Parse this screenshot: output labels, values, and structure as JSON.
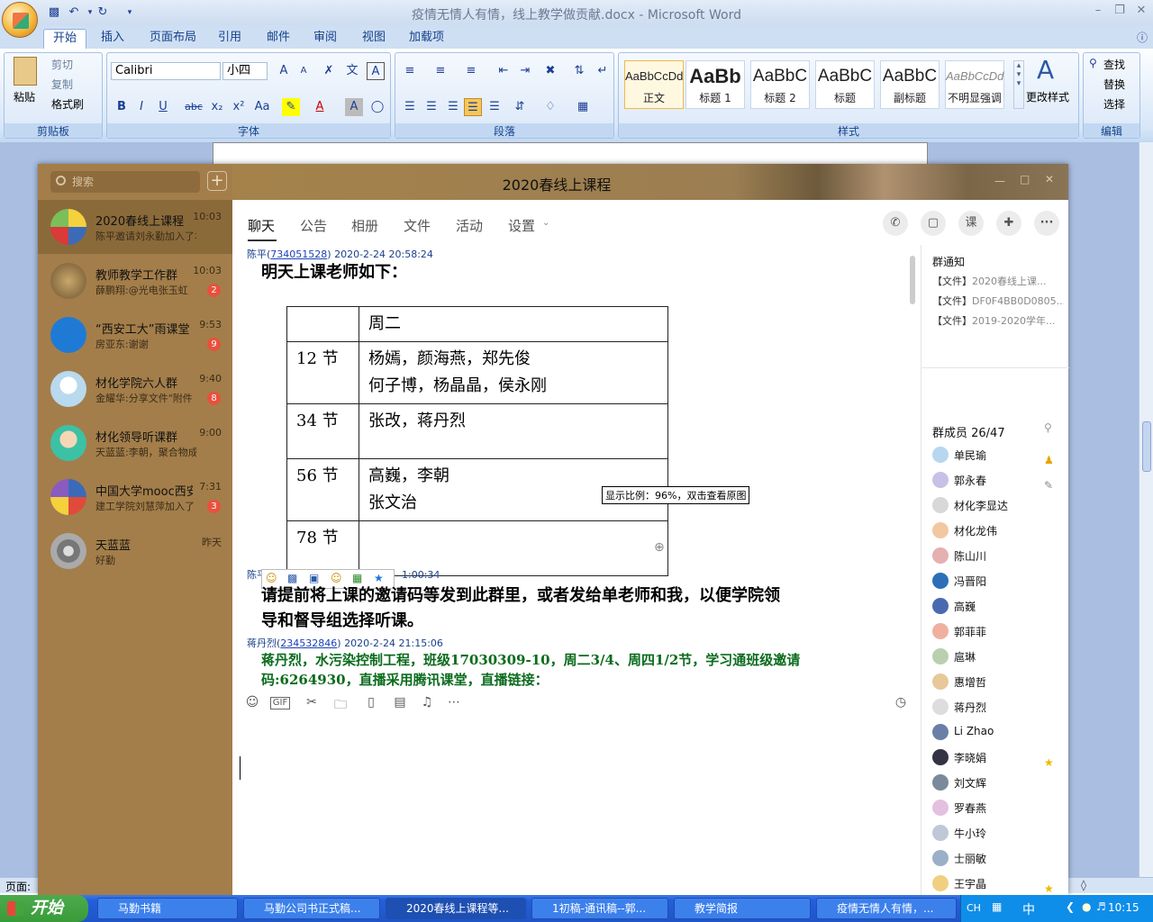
{
  "word": {
    "title": "疫情无情人有情，线上教学做贡献.docx - Microsoft Word",
    "tabs": [
      "开始",
      "插入",
      "页面布局",
      "引用",
      "邮件",
      "审阅",
      "视图",
      "加载项"
    ],
    "clipboard": {
      "paste": "粘贴",
      "cut": "剪切",
      "copy": "复制",
      "format_painter": "格式刷",
      "label": "剪贴板"
    },
    "font": {
      "family": "Calibri",
      "size": "小四",
      "label": "字体"
    },
    "paragraph_label": "段落",
    "styles": [
      {
        "sample": "AaBbCcDd",
        "name": "正文"
      },
      {
        "sample": "AaBb",
        "name": "标题 1"
      },
      {
        "sample": "AaBbC",
        "name": "标题 2"
      },
      {
        "sample": "AaBbC",
        "name": "标题"
      },
      {
        "sample": "AaBbC",
        "name": "副标题"
      },
      {
        "sample": "AaBbCcDd",
        "name": "不明显强调"
      }
    ],
    "styles_label": "样式",
    "change_styles": "更改样式",
    "editing": {
      "find": "查找",
      "replace": "替换",
      "select": "选择",
      "label": "编辑"
    },
    "status_page": "页面: "
  },
  "qq": {
    "title": "2020春线上课程",
    "search_placeholder": "搜索",
    "conversations": [
      {
        "name": "2020春线上课程",
        "msg": "陈平邀请刘永勤加入了本群",
        "time": "10:03",
        "badge": ""
      },
      {
        "name": "教师教学工作群",
        "msg": "薛鹏翔:@光电张玉虹",
        "time": "10:03",
        "badge": "2"
      },
      {
        "name": "“西安工大”雨课堂",
        "msg": "房亚东:谢谢",
        "time": "9:53",
        "badge": "9"
      },
      {
        "name": "材化学院六人群",
        "msg": "金耀华:分享文件\"附件",
        "time": "9:40",
        "badge": "8"
      },
      {
        "name": "材化领导听课群",
        "msg": "天蓝蓝:李朝，聚合物成型",
        "time": "9:00",
        "badge": ""
      },
      {
        "name": "中国大学mooc西安",
        "msg": "建工学院刘慧萍加入了",
        "time": "7:31",
        "badge": "3"
      },
      {
        "name": "天蓝蓝",
        "msg": "好勤",
        "time": "昨天",
        "badge": ""
      }
    ],
    "tabs": [
      "聊天",
      "公告",
      "相册",
      "文件",
      "活动",
      "设置"
    ],
    "actions": [
      "课"
    ],
    "messages": [
      {
        "sender": "陈平",
        "id": "734051528",
        "time": "2020-2-24 20:58:24",
        "text": "明天上课老师如下："
      },
      {
        "sender": "陈平",
        "id": "",
        "time": "1:00:34",
        "text": "请提前将上课的邀请码等发到此群里，或者发给单老师和我，以便学院领",
        "text2": "导和督导组选择听课。"
      },
      {
        "sender": "蒋丹烈",
        "id": "234532846",
        "time": "2020-2-24 21:15:06",
        "text": "蒋丹烈，水污染控制工程，班级17030309-10，周二3/4、周四1/2节，学习通班级邀请",
        "text2": "码:6264930，直播采用腾讯课堂，直播链接："
      }
    ],
    "schedule": {
      "header": [
        "",
        "周二"
      ],
      "rows": [
        {
          "slot": "12 节",
          "line1": "杨嫣，颜海燕，郑先俊",
          "line2": "何子博，杨晶晶，侯永刚"
        },
        {
          "slot": "34 节",
          "line1": "张改，蒋丹烈",
          "line2": ""
        },
        {
          "slot": "56 节",
          "line1": "高巍，李朝",
          "line2": "张文治"
        },
        {
          "slot": "78 节",
          "line1": "",
          "line2": ""
        }
      ]
    },
    "zoom_tip": "显示比例：96%，双击查看原图",
    "notice_title": "群通知",
    "notices": [
      {
        "tag": "【文件】",
        "name": "2020春线上课..."
      },
      {
        "tag": "【文件】",
        "name": "DF0F4BB0D0805..."
      },
      {
        "tag": "【文件】",
        "name": "2019-2020学年..."
      }
    ],
    "members_title": "群成员 26/47",
    "members": [
      "单民瑜",
      "郭永春",
      "材化李显达",
      "材化龙伟",
      "陈山川",
      "冯晋阳",
      "高巍",
      "郭菲菲",
      "扈琳",
      "惠增哲",
      "蒋丹烈",
      "Li Zhao",
      "李晓娟",
      "刘文辉",
      "罗春燕",
      "牛小玲",
      "士丽敏",
      "王宇晶"
    ]
  },
  "taskbar": {
    "start": "开始",
    "items": [
      "马勤书籍",
      "马勤公司书正式稿...",
      "2020春线上课程等...",
      "1初稿-通讯稿--郭...",
      "教学简报",
      "疫情无情人有情，..."
    ],
    "lang": "CH",
    "ime": "中",
    "clock": "10:15"
  }
}
